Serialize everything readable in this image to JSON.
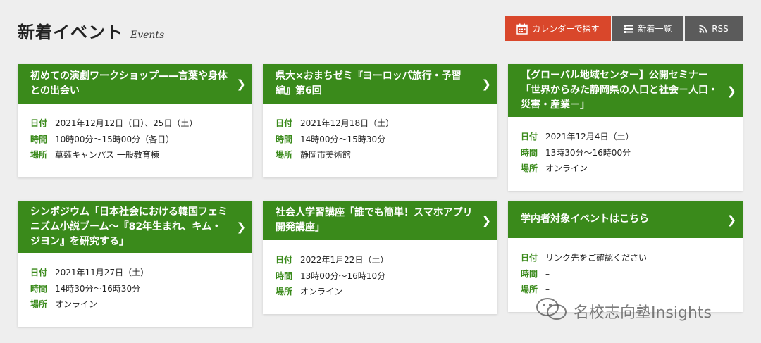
{
  "header": {
    "title": "新着イベント",
    "subtitle": "Events"
  },
  "buttons": {
    "calendar": "カレンダーで探す",
    "list": "新着一覧",
    "rss": "RSS"
  },
  "labels": {
    "date": "日付",
    "time": "時間",
    "place": "場所"
  },
  "events": [
    {
      "title": "初めての演劇ワークショップ——言葉や身体との出会い",
      "date": "2021年12月12日（日）、25日（土）",
      "time": "10時00分～15時00分（各日）",
      "place": "草薙キャンパス 一般教育棟"
    },
    {
      "title": "県大×おまちゼミ『ヨーロッパ旅行・予習編』第6回",
      "date": "2021年12月18日（土）",
      "time": "14時00分～15時30分",
      "place": "静岡市美術館"
    },
    {
      "title": "【グローバル地域センター】公開セミナー「世界からみた静岡県の人口と社会－人口・災害・産業－」",
      "date": "2021年12月4日（土）",
      "time": "13時30分～16時00分",
      "place": "オンライン"
    },
    {
      "title": "シンポジウム「日本社会における韓国フェミニズム小説ブーム～『82年生まれ、キム・ジヨン』を研究する」",
      "date": "2021年11月27日（土）",
      "time": "14時30分～16時30分",
      "place": "オンライン"
    },
    {
      "title": "社会人学習講座「誰でも簡単！スマホアプリ開発講座」",
      "date": "2022年1月22日（土）",
      "time": "13時00分～16時10分",
      "place": "オンライン"
    },
    {
      "title": "学内者対象イベントはこちら",
      "date": "リンク先をご確認ください",
      "time": "–",
      "place": "–"
    }
  ],
  "watermark": "名校志向塾Insights",
  "colors": {
    "accent_green": "#3a8a1b",
    "calendar_red": "#d9472b",
    "button_gray": "#5b5b5b"
  }
}
